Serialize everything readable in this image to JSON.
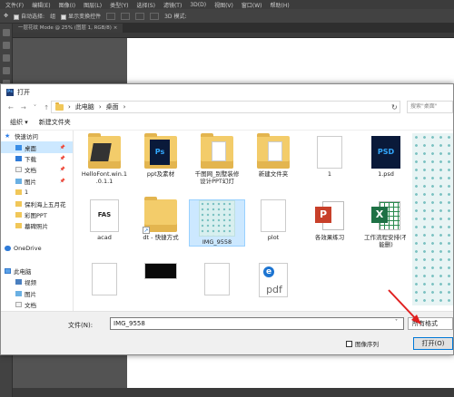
{
  "photoshop": {
    "menu": [
      "文件(F)",
      "编辑(E)",
      "图像(I)",
      "图层(L)",
      "类型(Y)",
      "选择(S)",
      "滤镜(T)",
      "3D(D)",
      "视图(V)",
      "窗口(W)",
      "帮助(H)"
    ],
    "options": {
      "auto_select": "自动选择:",
      "layer_value": "组",
      "show_transform": "显示变换控件",
      "mode_3d": "3D 模式:"
    },
    "doc_tab": "一层花纹 Mode @ 25% (图层 1, RGB/8) ×"
  },
  "dialog": {
    "title": "打开",
    "breadcrumb": [
      "此电脑",
      "桌面"
    ],
    "search_placeholder": "搜索\"桌面\"",
    "cmd_organize": "组织 ▾",
    "cmd_new_folder": "新建文件夹",
    "nav": [
      {
        "label": "快速访问",
        "icon": "star",
        "pinned": false,
        "selected": false,
        "indent": 0
      },
      {
        "label": "桌面",
        "icon": "blue",
        "pinned": true,
        "selected": true,
        "indent": 1
      },
      {
        "label": "下载",
        "icon": "dl",
        "pinned": true,
        "selected": false,
        "indent": 1
      },
      {
        "label": "文档",
        "icon": "doc",
        "pinned": true,
        "selected": false,
        "indent": 1
      },
      {
        "label": "图片",
        "icon": "pic",
        "pinned": true,
        "selected": false,
        "indent": 1
      },
      {
        "label": "1",
        "icon": "yellow",
        "pinned": false,
        "selected": false,
        "indent": 1
      },
      {
        "label": "保利海上五月花",
        "icon": "yellow",
        "pinned": false,
        "selected": false,
        "indent": 1
      },
      {
        "label": "彩图PPT",
        "icon": "yellow",
        "pinned": false,
        "selected": false,
        "indent": 1
      },
      {
        "label": "墓碑照片",
        "icon": "yellow",
        "pinned": false,
        "selected": false,
        "indent": 1
      },
      {
        "label": "",
        "icon": "",
        "pinned": false,
        "selected": false,
        "indent": 0
      },
      {
        "label": "OneDrive",
        "icon": "cloud",
        "pinned": false,
        "selected": false,
        "indent": 0
      },
      {
        "label": "",
        "icon": "",
        "pinned": false,
        "selected": false,
        "indent": 0
      },
      {
        "label": "此电脑",
        "icon": "pc",
        "pinned": false,
        "selected": false,
        "indent": 0
      },
      {
        "label": "视频",
        "icon": "vid",
        "pinned": false,
        "selected": false,
        "indent": 1
      },
      {
        "label": "图片",
        "icon": "pic",
        "pinned": false,
        "selected": false,
        "indent": 1
      },
      {
        "label": "文档",
        "icon": "doc",
        "pinned": false,
        "selected": false,
        "indent": 1
      }
    ],
    "files": [
      {
        "label": "HelloFont.win.1\n.0.1.1",
        "kind": "folder-hellofont",
        "selected": false
      },
      {
        "label": "ppt及素材",
        "kind": "folder-ps",
        "selected": false
      },
      {
        "label": "千图网_别墅装修\n设计PPT幻灯",
        "kind": "folder",
        "selected": false
      },
      {
        "label": "新建文件夹",
        "kind": "folder-paper",
        "selected": false
      },
      {
        "label": "1",
        "kind": "plain-doc",
        "selected": false
      },
      {
        "label": "1.psd",
        "kind": "ps-big",
        "selected": false
      },
      {
        "label": "acad",
        "kind": "acad",
        "selected": false
      },
      {
        "label": "dt - 快捷方式",
        "kind": "shortcut",
        "selected": false
      },
      {
        "label": "IMG_9558",
        "kind": "pattern",
        "selected": true
      },
      {
        "label": "plot",
        "kind": "plain-doc",
        "selected": false
      },
      {
        "label": "各效果练习",
        "kind": "ppt",
        "selected": false
      },
      {
        "label": "工作流程安排(不\n能删)",
        "kind": "xls",
        "selected": false
      },
      {
        "label": "",
        "kind": "plain-doc",
        "selected": false
      },
      {
        "label": "",
        "kind": "dark-doc",
        "selected": false
      },
      {
        "label": "",
        "kind": "plain-doc",
        "selected": false
      },
      {
        "label": "",
        "kind": "pdf",
        "selected": false
      }
    ],
    "acad_text": "FAS",
    "pdf_text": "pdf",
    "filename_label": "文件(N):",
    "filename_value": "IMG_9558",
    "filetype_value": "所有格式",
    "sequence_label": "图像序列",
    "open_label": "打开(O)"
  }
}
